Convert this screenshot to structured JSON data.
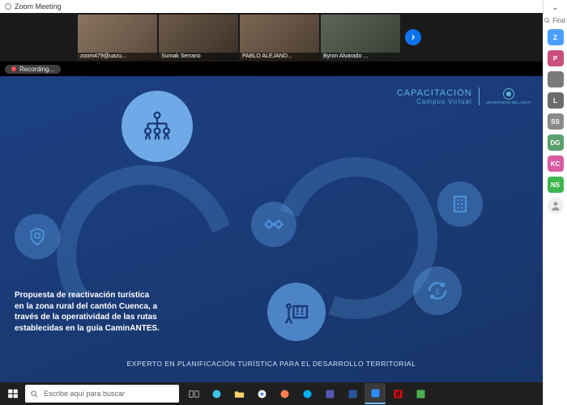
{
  "window": {
    "title": "Zoom Meeting"
  },
  "gallery": {
    "tiles": [
      {
        "label": "zoom479@uazu..."
      },
      {
        "label": "Sumak Serrano"
      },
      {
        "label": "PABLO ALEJAND..."
      },
      {
        "label": "Byron Alvarado ..."
      }
    ]
  },
  "recording": {
    "label": "Recording..."
  },
  "slide": {
    "brand_line1": "CAPACITACIÓN",
    "brand_line2": "Campus Virtual",
    "brand_org": "UNIVERSIDAD DEL AZUAY",
    "caption": "Propuesta de reactivación turística en la zona rural del cantón Cuenca, a través de la operatividad de las rutas establecidas en la guía CaminANTES.",
    "footer": "EXPERTO EN PLANIFICACIÓN TURÍSTICA PARA EL DESARROLLO TERRITORIAL"
  },
  "taskbar": {
    "search_placeholder": "Escribe aquí para buscar"
  },
  "side": {
    "find": "Find",
    "items": [
      {
        "initials": "Z",
        "color": "#4a9eff"
      },
      {
        "initials": "P",
        "color": "#c94f7c"
      },
      {
        "initials": "",
        "color": "#7a7a7a"
      },
      {
        "initials": "L",
        "color": "#6b6b6b"
      },
      {
        "initials": "SS",
        "color": "#8a8a8a"
      },
      {
        "initials": "DG",
        "color": "#5aa06e"
      },
      {
        "initials": "KC",
        "color": "#d95ba3"
      },
      {
        "initials": "NS",
        "color": "#3fb54f"
      }
    ]
  }
}
